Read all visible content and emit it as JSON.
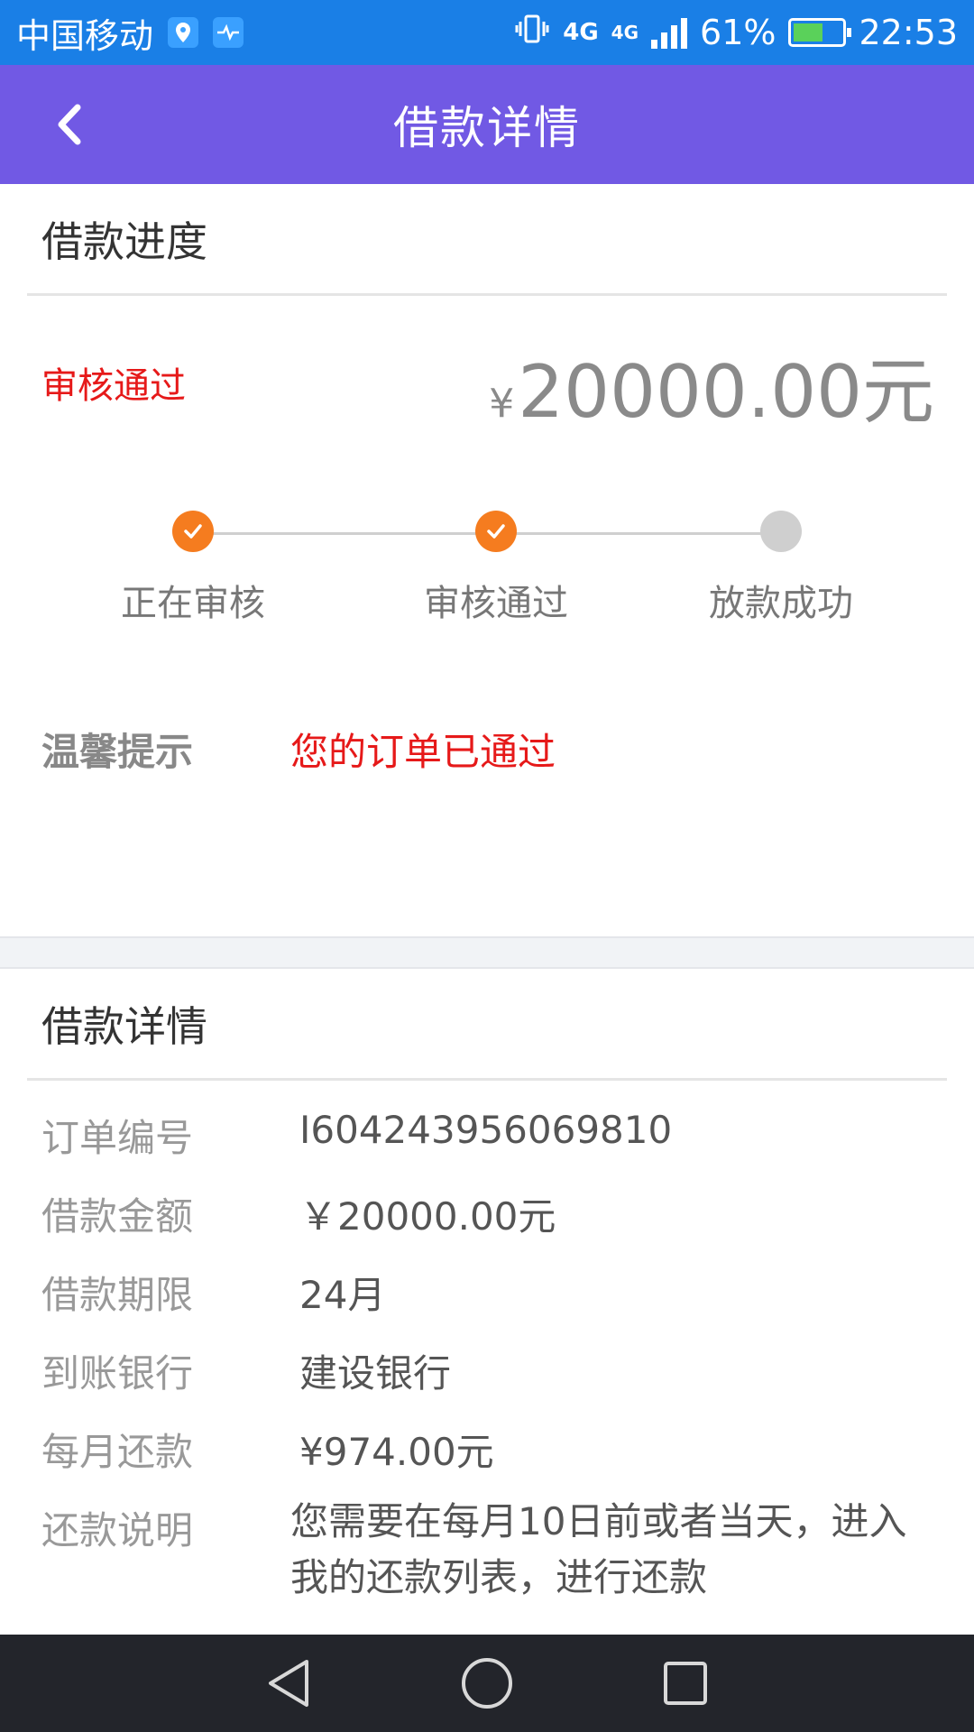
{
  "status_bar": {
    "carrier": "中国移动",
    "network_1": "4G",
    "network_2": "4G",
    "battery": "61%",
    "time": "22:53",
    "icons": [
      "location-icon",
      "health-icon",
      "vibrate-icon",
      "signal-icon",
      "battery-icon"
    ],
    "battery_level": 0.61
  },
  "app_bar": {
    "title": "借款详情",
    "back_icon": "chevron-left-icon"
  },
  "progress_section": {
    "title": "借款进度",
    "status": "审核通过",
    "amount_currency": "¥",
    "amount_value": "20000.00元",
    "steps": [
      {
        "label": "正在审核",
        "state": "done"
      },
      {
        "label": "审核通过",
        "state": "done"
      },
      {
        "label": "放款成功",
        "state": "todo"
      }
    ],
    "tip_label": "温馨提示",
    "tip_value": "您的订单已通过"
  },
  "detail_section": {
    "title": "借款详情",
    "rows": [
      {
        "label": "订单编号",
        "value": "I604243956069810"
      },
      {
        "label": "借款金额",
        "value": "￥20000.00元"
      },
      {
        "label": "借款期限",
        "value": "24月"
      },
      {
        "label": "到账银行",
        "value": "建设银行"
      },
      {
        "label": "每月还款",
        "value": "¥974.00元"
      },
      {
        "label": "还款说明",
        "value": "您需要在每月10日前或者当天，进入我的还款列表，进行还款"
      }
    ]
  },
  "nav_bar": {
    "icons": [
      "back-triangle-icon",
      "home-circle-icon",
      "recents-square-icon"
    ]
  },
  "colors": {
    "status_bar": "#1a7fe6",
    "app_bar": "#7159e4",
    "accent_red": "#e61919",
    "step_done": "#f57c1f",
    "step_todo": "#cfcfcf"
  }
}
